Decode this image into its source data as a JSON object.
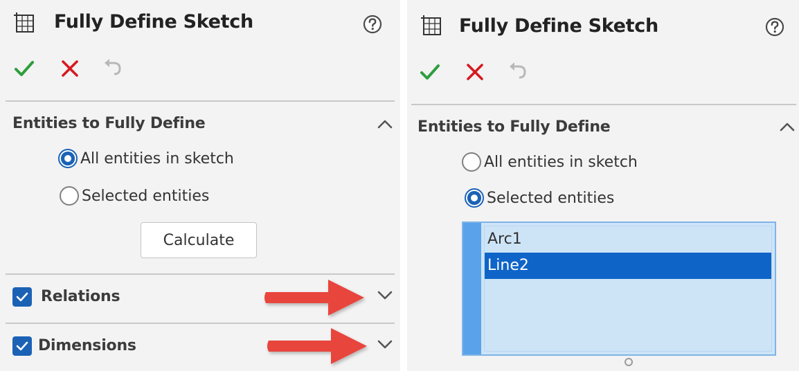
{
  "left_panel": {
    "title": "Fully Define Sketch",
    "section_entities": {
      "title": "Entities to Fully Define",
      "options": [
        {
          "label": "All entities in sketch",
          "checked": true
        },
        {
          "label": "Selected entities",
          "checked": false
        }
      ],
      "calculate_label": "Calculate"
    },
    "section_relations": {
      "label": "Relations",
      "checked": true
    },
    "section_dimensions": {
      "label": "Dimensions",
      "checked": true
    }
  },
  "right_panel": {
    "title": "Fully Define Sketch",
    "section_entities": {
      "title": "Entities to Fully Define",
      "options": [
        {
          "label": "All entities in sketch",
          "checked": false
        },
        {
          "label": "Selected entities",
          "checked": true
        }
      ],
      "selected_entities": [
        {
          "label": "Arc1",
          "selected": false
        },
        {
          "label": "Line2",
          "selected": true
        }
      ]
    }
  },
  "icons": {
    "sketch": "grid-sketch-icon",
    "help": "help-circle-icon",
    "ok": "green-checkmark-icon",
    "cancel": "red-x-icon",
    "undo": "undo-arrow-icon",
    "collapse": "chevron-up-icon",
    "expand": "chevron-down-icon",
    "annotation": "red-arrow-icon"
  },
  "colors": {
    "accent_blue": "#1b62b5",
    "ok_green": "#2e9e3e",
    "cancel_red": "#d71920",
    "arrow_red": "#e8453c",
    "selection_blue": "#0f64c8",
    "list_background": "#cde4f7"
  }
}
